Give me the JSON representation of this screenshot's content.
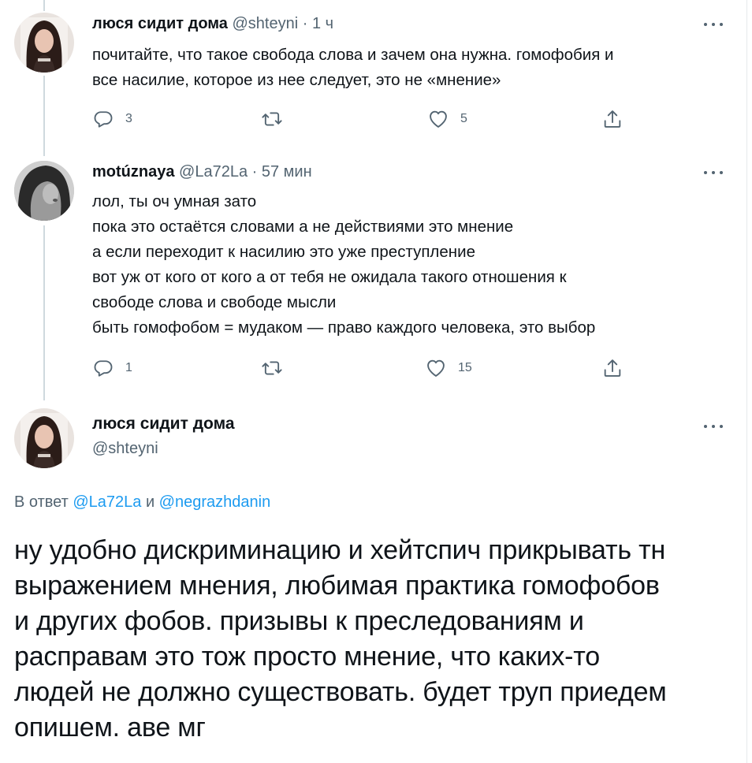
{
  "tweet1": {
    "name": "люся сидит дома",
    "handle": "@shteyni",
    "dot": "·",
    "time": "1 ч",
    "lines": [
      "почитайте, что такое свобода слова и зачем она нужна. гомофобия и",
      "все насилие, которое из нее следует, это не «мнение»"
    ],
    "replies": "3",
    "likes": "5"
  },
  "tweet2": {
    "name": "motúznaya",
    "handle": "@La72La",
    "dot": "·",
    "time": "57 мин",
    "lines": [
      "лол, ты оч умная зато",
      "пока это остаётся словами а не действиями это мнение",
      "а если переходит к насилию это уже преступление",
      "вот уж от кого от кого а от тебя не ожидала такого отношения к",
      "свободе слова и свободе мысли",
      "быть гомофобом = мудаком — право каждого человека, это выбор"
    ],
    "replies": "1",
    "likes": "15"
  },
  "main": {
    "name": "люся сидит дома",
    "handle": "@shteyni",
    "reply_prefix": "В ответ",
    "reply_user1": "@La72La",
    "reply_and": "и",
    "reply_user2": "@negrazhdanin",
    "lines": [
      "ну удобно дискриминацию и хейтспич прикрывать тн",
      "выражением мнения, любимая практика гомофобов",
      "и других фобов. призывы к преследованиям и",
      "расправам это тож просто мнение, что каких-то",
      "людей не должно существовать. будет труп приедем",
      "опишем. аве мг"
    ]
  },
  "icons": {
    "reply": "reply-icon",
    "retweet": "retweet-icon",
    "like": "heart-icon",
    "share": "share-icon",
    "more": "more-icon"
  },
  "colors": {
    "text": "#0f1419",
    "secondary": "#536471",
    "link": "#1d9bf0",
    "thread_line": "#cfd9de"
  }
}
